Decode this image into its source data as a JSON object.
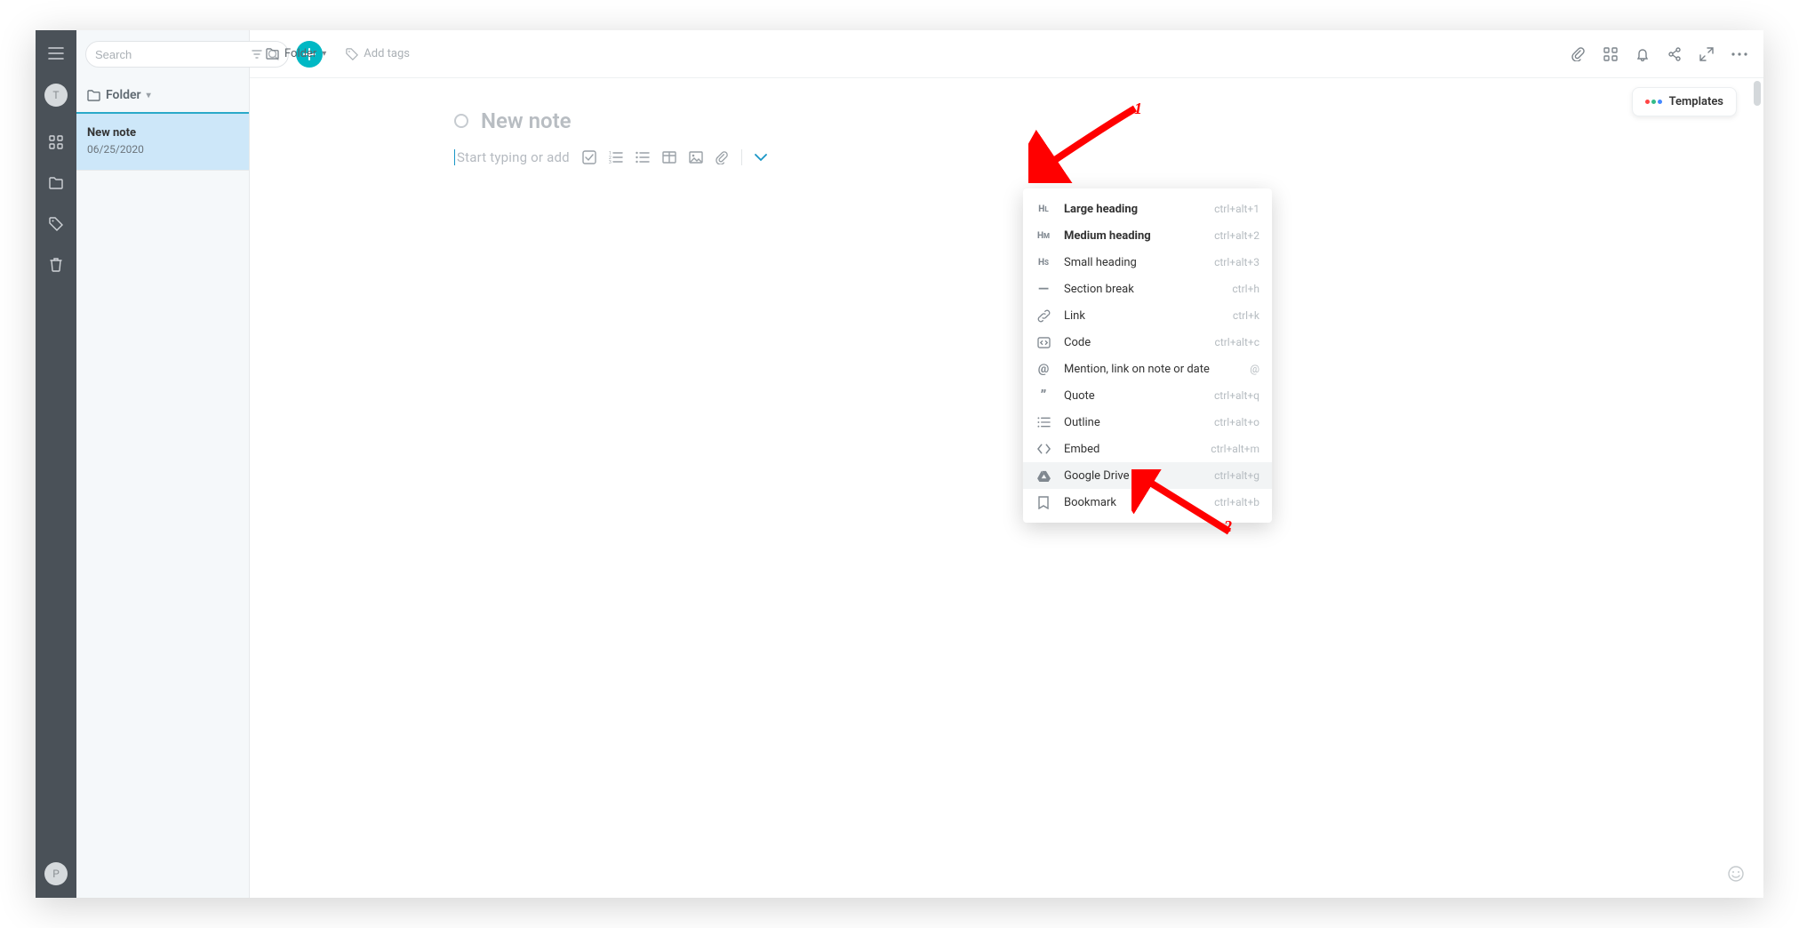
{
  "search": {
    "placeholder": "Search"
  },
  "rail": {
    "top_avatar_letter": "T",
    "bottom_avatar_letter": "P"
  },
  "list": {
    "folder_label": "Folder",
    "notes": [
      {
        "title": "New note",
        "date": "06/25/2020"
      }
    ]
  },
  "topbar": {
    "breadcrumb_label": "Folder",
    "add_tags_placeholder": "Add tags"
  },
  "editor": {
    "note_title": "New note",
    "compose_placeholder": "Start typing or add"
  },
  "templates": {
    "label": "Templates"
  },
  "dropdown": {
    "items": [
      {
        "icon": "HL",
        "label": "Large heading",
        "shortcut": "ctrl+alt+1",
        "bold": true
      },
      {
        "icon": "HM",
        "label": "Medium heading",
        "shortcut": "ctrl+alt+2",
        "bold": true
      },
      {
        "icon": "HS",
        "label": "Small heading",
        "shortcut": "ctrl+alt+3"
      },
      {
        "icon": "—",
        "label": "Section break",
        "shortcut": "ctrl+h"
      },
      {
        "icon": "link",
        "label": "Link",
        "shortcut": "ctrl+k"
      },
      {
        "icon": "code",
        "label": "Code",
        "shortcut": "ctrl+alt+c"
      },
      {
        "icon": "@",
        "label": "Mention, link on note or date",
        "shortcut": "@"
      },
      {
        "icon": "quote",
        "label": "Quote",
        "shortcut": "ctrl+alt+q"
      },
      {
        "icon": "list",
        "label": "Outline",
        "shortcut": "ctrl+alt+o"
      },
      {
        "icon": "embed",
        "label": "Embed",
        "shortcut": "ctrl+alt+m"
      },
      {
        "icon": "drive",
        "label": "Google Drive",
        "shortcut": "ctrl+alt+g",
        "hover": true
      },
      {
        "icon": "bookmark",
        "label": "Bookmark",
        "shortcut": "ctrl+alt+b"
      }
    ]
  },
  "annotations": {
    "label1": "1",
    "label2": "2"
  }
}
